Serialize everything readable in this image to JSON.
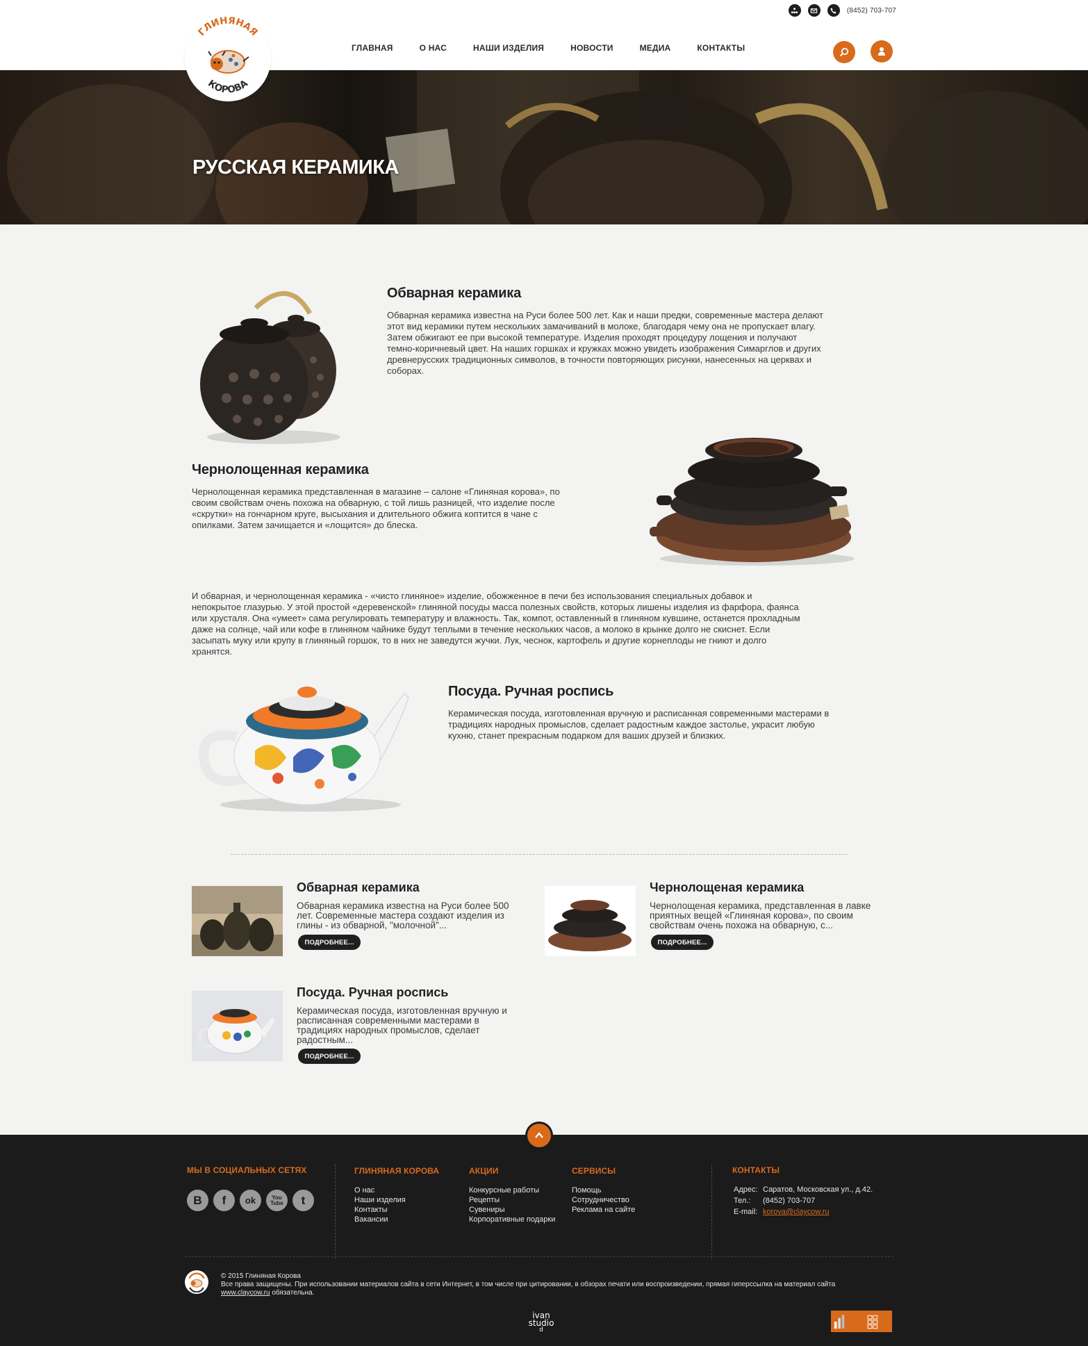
{
  "header": {
    "phone": "(8452) 703-707",
    "logo_text_top": "ГЛИНЯНАЯ",
    "logo_text_bottom": "КОРОВА",
    "nav": [
      {
        "label": "ГЛАВНАЯ"
      },
      {
        "label": "О НАС"
      },
      {
        "label": "НАШИ ИЗДЕЛИЯ"
      },
      {
        "label": "НОВОСТИ"
      },
      {
        "label": "МЕДИА"
      },
      {
        "label": "КОНТАКТЫ"
      }
    ],
    "icons": [
      "sitemap-icon",
      "mail-icon",
      "phone-icon",
      "search-icon",
      "user-icon"
    ]
  },
  "hero": {
    "title": "РУССКАЯ КЕРАМИКА"
  },
  "sections": [
    {
      "title": "Обварная керамика",
      "lines": [
        "Обварная керамика известна на Руси более 500 лет. Как и наши предки, современные мастера делают",
        "этот вид керамики путем нескольких замачиваний в молоке, благодаря чему она не пропускает влагу.",
        "Затем обжигают ее при высокой температуре. Изделия проходят процедуру лощения и получают",
        "темно-коричневый цвет. На наших горшках и кружках можно увидеть изображения Симарглов и других",
        "древнерусских традиционных символов, в точности повторяющих рисунки, нанесенных на церквах и",
        "соборах."
      ]
    },
    {
      "title": "Чернолощенная керамика",
      "lines": [
        "Чернолощенная керамика представленная в магазине – салоне «Глиняная корова», по",
        "своим свойствам очень похожа на обварную, с той лишь разницей, что изделие после",
        "«скрутки» на гончарном круге, высыхания и длительного обжига коптится в чане с",
        "опилками. Затем зачищается и «лощится» до блеска."
      ]
    },
    {
      "lines": [
        "И обварная, и чернолощенная керамика - «чисто глиняное» изделие, обожженное в печи без использования специальных добавок и",
        "непокрытое глазурью. У этой простой «деревенской» глиняной посуды масса полезных свойств, которых лишены изделия из фарфора, фаянса",
        "или хрусталя. Она «умеет» сама регулировать температуру и влажность. Так, компот, оставленный в глиняном кувшине, останется прохладным",
        "даже на солнце, чай или кофе в глиняном чайнике будут теплыми в течение нескольких часов, а молоко в крынке долго не скиснет. Если",
        "засыпать муку или крупу в глиняный горшок, то в них не заведутся жучки. Лук, чеснок, картофель и другие корнеплоды не гниют и долго",
        "хранятся."
      ]
    },
    {
      "title": "Посуда. Ручная роспись",
      "lines": [
        "Керамическая посуда, изготовленная вручную и расписанная современными мастерами в",
        "традициях народных промыслов, сделает радостным каждое застолье, украсит любую",
        "кухню, станет прекрасным подарком для ваших друзей и близких."
      ]
    }
  ],
  "cards": [
    {
      "title": "Обварная керамика",
      "lines": [
        "Обварная керамика известна на Руси более 500",
        "лет. Современные мастера создают изделия из",
        "глины - из обварной, \"молочной\"..."
      ],
      "button": "ПОДРОБНЕЕ..."
    },
    {
      "title": "Чернолощеная керамика",
      "lines": [
        "Чернолощеная керамика, представленная в лавке",
        "приятных вещей «Глиняная корова», по своим",
        "свойствам очень похожа на обварную, с..."
      ],
      "button": "ПОДРОБНЕЕ..."
    },
    {
      "title": "Посуда. Ручная роспись",
      "lines": [
        "Керамическая посуда, изготовленная вручную и",
        "расписанная современными мастерами в",
        "традициях народных промыслов, сделает",
        "радостным..."
      ],
      "button": "ПОДРОБНЕЕ..."
    }
  ],
  "footer": {
    "social_title": "МЫ В СОЦИАЛЬНЫХ СЕТЯХ",
    "social": [
      {
        "name": "vkontakte-icon",
        "glyph": "B"
      },
      {
        "name": "facebook-icon",
        "glyph": "f"
      },
      {
        "name": "odnoklassniki-icon",
        "glyph": "ok"
      },
      {
        "name": "youtube-icon",
        "glyph": "You Tube"
      },
      {
        "name": "twitter-icon",
        "glyph": "t"
      }
    ],
    "columns": [
      {
        "title": "ГЛИНЯНАЯ КОРОВА",
        "links": [
          "О нас",
          "Наши изделия",
          "Контакты",
          "Вакансии"
        ]
      },
      {
        "title": "АКЦИИ",
        "links": [
          "Конкурсные работы",
          "Рецепты",
          "Сувениры",
          "Корпоративные подарки"
        ]
      },
      {
        "title": "СЕРВИСЫ",
        "links": [
          "Помощь",
          "Сотрудничество",
          "Реклама на сайте"
        ]
      }
    ],
    "contacts": {
      "title": "КОНТАКТЫ",
      "address_label": "Адрес:",
      "address": "Саратов, Московская ул., д.42.",
      "phone_label": "Тел.:",
      "phone": "(8452) 703-707",
      "email_label": "E-mail:",
      "email": "korova@claycow.ru"
    },
    "copyright": "© 2015 Глиняная Корова",
    "rights": "Все права защищены. При использовании материалов сайта в сети Интернет, в том числе при цитировании, в обзорах печати или воспроизведении, прямая гиперссылка на материал сайта",
    "site_link": "www.claycow.ru",
    "rights_tail": "обязательна.",
    "studio_line1": "ivan",
    "studio_line2": "studio",
    "studio_letter": "d"
  },
  "colors": {
    "accent": "#d86a1c",
    "footer_bg": "#1b1b1b",
    "page_bg": "#f3f3f2"
  }
}
